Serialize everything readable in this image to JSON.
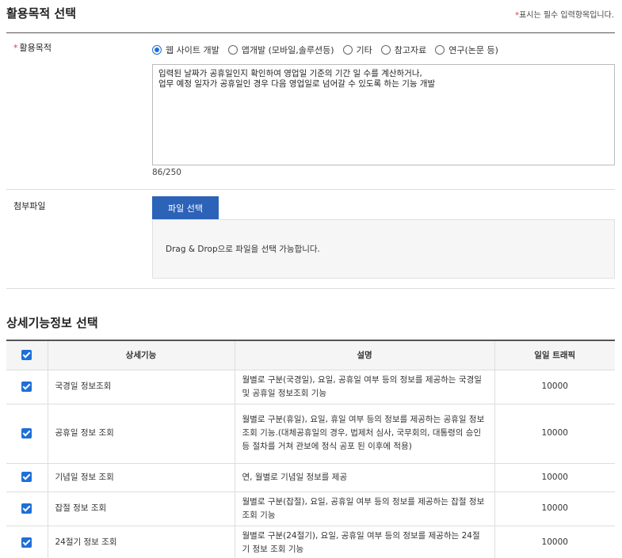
{
  "purpose_section": {
    "title": "활용목적 선택",
    "required_note_star": "*",
    "required_note": "표시는 필수 입력항목입니다.",
    "field_label": "활용목적",
    "field_star": "*",
    "options": [
      {
        "label": "웹 사이트 개발",
        "checked": true
      },
      {
        "label": "앱개발 (모바일,솔루션등)",
        "checked": false
      },
      {
        "label": "기타",
        "checked": false
      },
      {
        "label": "참고자료",
        "checked": false
      },
      {
        "label": "연구(논문 등)",
        "checked": false
      }
    ],
    "textarea_value": "입력된 날짜가 공휴일인지 확인하여 영업일 기준의 기간 일 수를 계산하거나,\n업무 예정 일자가 공휴일인 경우 다음 영업일로 넘어갈 수 있도록 하는 기능 개발",
    "counter": "86/250"
  },
  "attachment": {
    "label": "첨부파일",
    "button": "파일 선택",
    "dropzone": "Drag & Drop으로 파일을 선택 가능합니다."
  },
  "detail_section": {
    "title": "상세기능정보 선택",
    "columns": [
      "상세기능",
      "설명",
      "일일 트래픽"
    ],
    "rows": [
      {
        "name": "국경일 정보조회",
        "desc": "월별로 구분(국경일), 요일, 공휴일 여부 등의 정보를 제공하는 국경일 및 공휴일 정보조회 기능",
        "traffic": "10000",
        "checked": true
      },
      {
        "name": "공휴일 정보 조회",
        "desc": "월별로 구분(휴일), 요일, 휴일 여부 등의 정보를 제공하는 공휴일 정보조회 기능.(대체공휴일의 경우, 법제처 심사, 국무회의, 대통령의 승인 등 절차를 거쳐 관보에 정식 공포 된 이후에 적용)",
        "traffic": "10000",
        "checked": true
      },
      {
        "name": "기념일 정보 조회",
        "desc": "연, 월별로 기념일 정보를 제공",
        "traffic": "10000",
        "checked": true
      },
      {
        "name": "잡절 정보 조회",
        "desc": "월별로 구분(잡절), 요일, 공휴일 여부 등의 정보를 제공하는 잡절 정보 조회 기능",
        "traffic": "10000",
        "checked": true
      },
      {
        "name": "24절기 정보 조회",
        "desc": "월별로 구분(24절기), 요일, 공휴일 여부 등의 정보를 제공하는 24절기 정보 조회 기능",
        "traffic": "10000",
        "checked": true
      }
    ]
  }
}
